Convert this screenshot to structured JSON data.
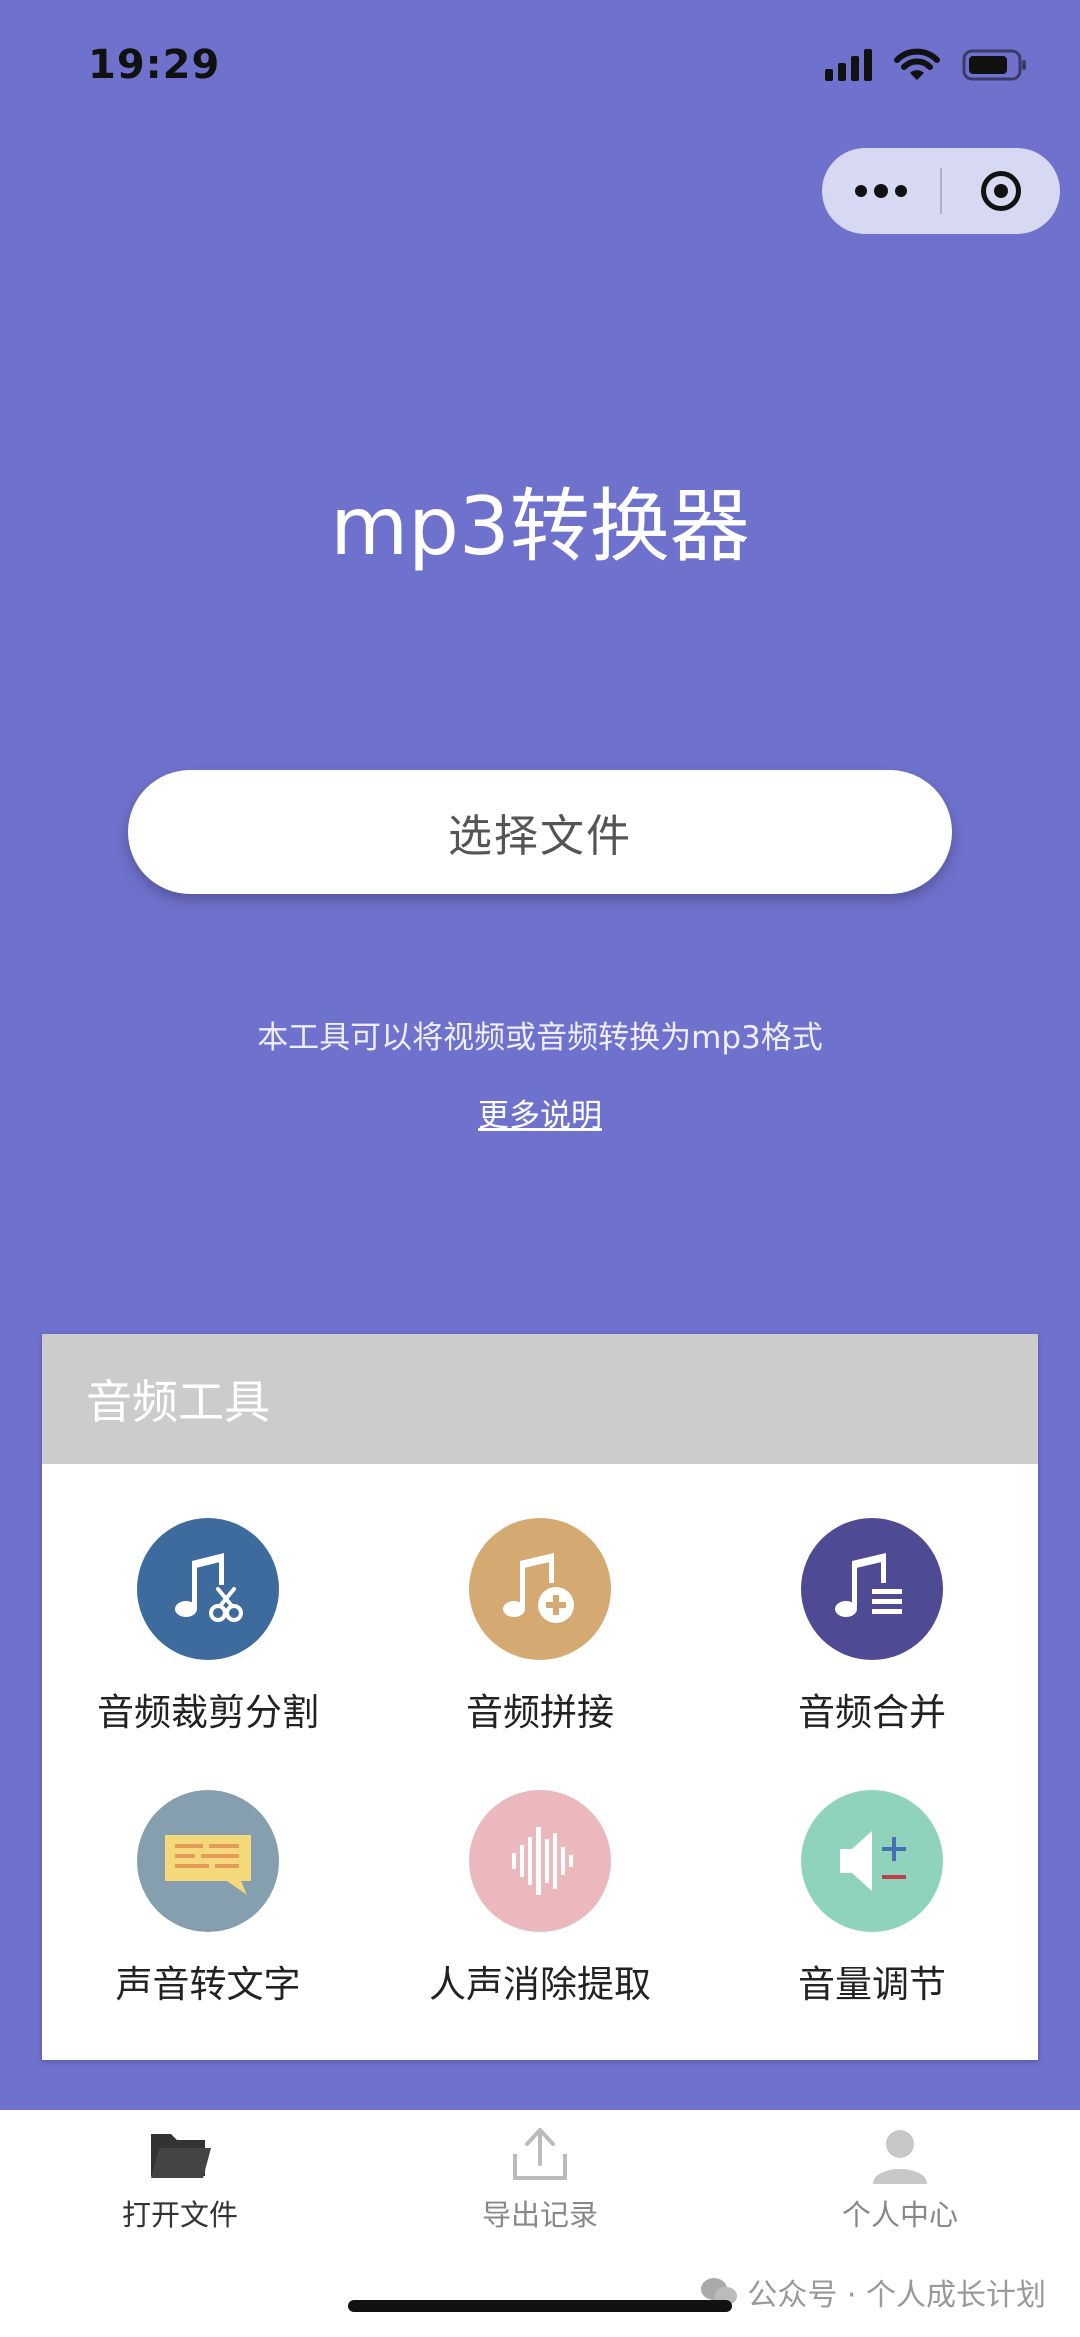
{
  "status_bar": {
    "time": "19:29"
  },
  "capsule": {
    "more_icon": "more-dots-icon",
    "close_icon": "target-icon"
  },
  "main": {
    "title": "mp3转换器",
    "select_button": "选择文件",
    "description": "本工具可以将视频或音频转换为mp3格式",
    "more_link": "更多说明"
  },
  "tools": {
    "header": "音频工具",
    "items": [
      {
        "label": "音频裁剪分割",
        "icon": "music-scissors-icon",
        "color": "#3e6b9e"
      },
      {
        "label": "音频拼接",
        "icon": "music-plus-icon",
        "color": "#d4aa72"
      },
      {
        "label": "音频合并",
        "icon": "music-list-icon",
        "color": "#4e4a94"
      },
      {
        "label": "声音转文字",
        "icon": "speech-bubble-icon",
        "color": "#869faf"
      },
      {
        "label": "人声消除提取",
        "icon": "waveform-icon",
        "color": "#eab8bd"
      },
      {
        "label": "音量调节",
        "icon": "speaker-plus-minus-icon",
        "color": "#8fd3bd"
      }
    ]
  },
  "tabbar": {
    "items": [
      {
        "label": "打开文件",
        "icon": "folder-icon",
        "active": true
      },
      {
        "label": "导出记录",
        "icon": "upload-icon",
        "active": false
      },
      {
        "label": "个人中心",
        "icon": "user-icon",
        "active": false
      }
    ]
  },
  "watermark": "公众号 · 个人成长计划",
  "colors": {
    "background": "#6f72cd",
    "card_header": "#cccccc",
    "tab_active": "#333333",
    "tab_inactive": "#888888"
  }
}
